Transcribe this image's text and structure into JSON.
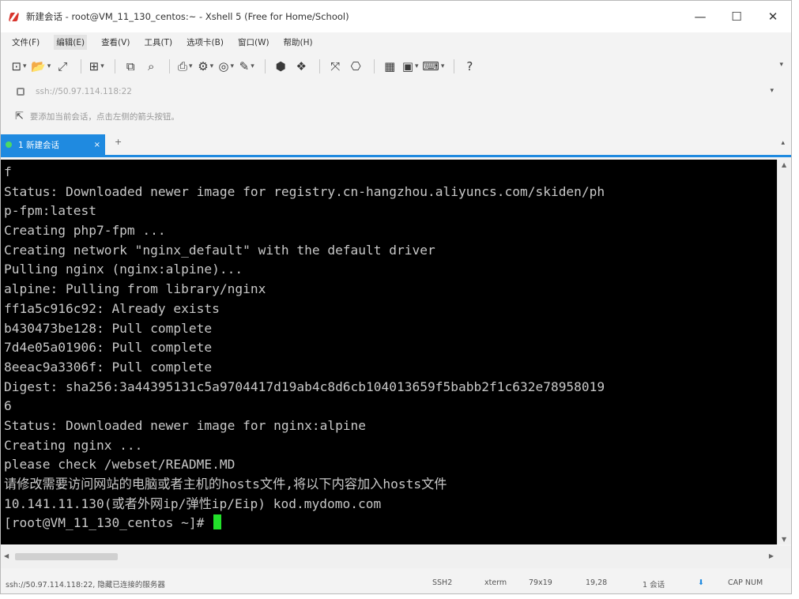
{
  "window": {
    "title": "新建会话 - root@VM_11_130_centos:~ - Xshell 5 (Free for Home/School)",
    "controls": {
      "minimize": "—",
      "maximize": "☐",
      "close": "✕"
    }
  },
  "menu": [
    "文件(F)",
    "编辑(E)",
    "查看(V)",
    "工具(T)",
    "选项卡(B)",
    "窗口(W)",
    "帮助(H)"
  ],
  "toolbar": {
    "icons": [
      "new-session-icon",
      "open-folder-icon",
      "disconnect-icon",
      "transfer-icon",
      "copy-icon",
      "find-icon",
      "print-icon",
      "properties-icon",
      "globe-icon",
      "script-icon",
      "xftp-icon",
      "xmanager-icon",
      "fullscreen-icon",
      "lock-icon",
      "compose-icon",
      "font-icon",
      "keyboard-icon",
      "help-icon"
    ],
    "glyphs": [
      "⊡",
      "📂",
      "⤢",
      "⊞",
      "⧉",
      "⌕",
      "⎙",
      "⚙",
      "◎",
      "✎",
      "⬢",
      "❖",
      "⤧",
      "⎔",
      "▦",
      "▣",
      "⌨",
      "?"
    ]
  },
  "address": {
    "value": "ssh://50.97.114.118:22"
  },
  "session_bar": {
    "text": "要添加当前会话，点击左侧的箭头按钮。"
  },
  "tabs": [
    {
      "label": "1 新建会话",
      "close": "×"
    }
  ],
  "tab_add": "+",
  "terminal": {
    "lines": [
      "f",
      "Status: Downloaded newer image for registry.cn-hangzhou.aliyuncs.com/skiden/ph",
      "p-fpm:latest",
      "Creating php7-fpm ...",
      "Creating network \"nginx_default\" with the default driver",
      "Pulling nginx (nginx:alpine)...",
      "alpine: Pulling from library/nginx",
      "ff1a5c916c92: Already exists",
      "b430473be128: Pull complete",
      "7d4e05a01906: Pull complete",
      "8eeac9a3306f: Pull complete",
      "Digest: sha256:3a44395131c5a9704417d19ab4c8d6cb104013659f5babb2f1c632e78958019",
      "6",
      "Status: Downloaded newer image for nginx:alpine",
      "Creating nginx ...",
      "please check /webset/README.MD",
      "请修改需要访问网站的电脑或者主机的hosts文件,将以下内容加入hosts文件",
      "10.141.11.130(或者外网ip/弹性ip/Eip) kod.mydomo.com"
    ],
    "prompt": "[root@VM_11_130_centos ~]# ",
    "cursor_color": "#22e02a",
    "background": "#000000",
    "foreground": "#c8c8c8"
  },
  "status": {
    "connection": "ssh://50.97.114.118:22, 隐藏已连接的服务器",
    "protocol": "SSH2",
    "term": "xterm",
    "size": "79x19",
    "position": "19,28",
    "sessions": "1 会话",
    "caps": "CAP NUM"
  },
  "colors": {
    "accent": "#1f8ae0",
    "tab_dot": "#4cd964"
  }
}
